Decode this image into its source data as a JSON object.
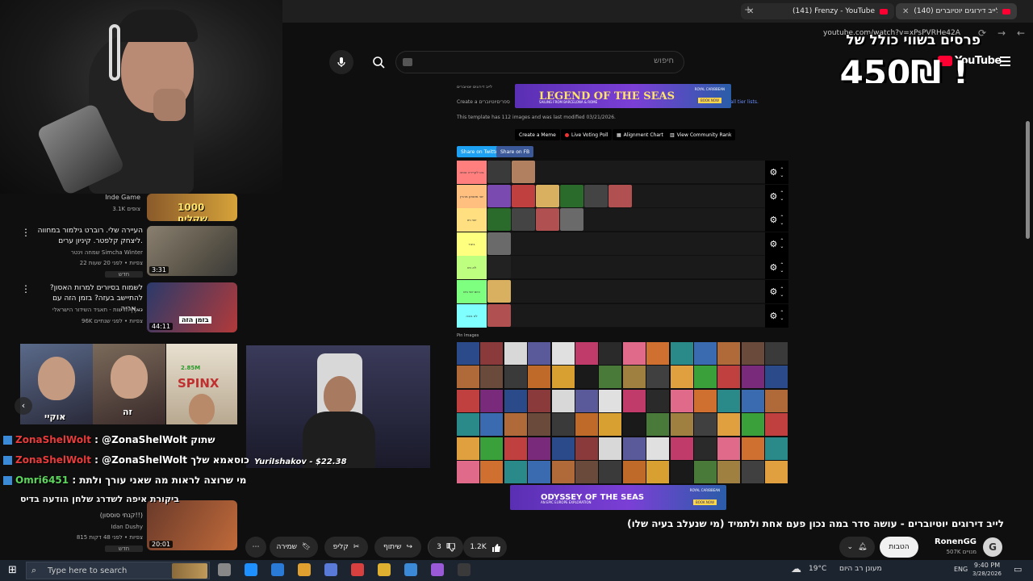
{
  "browser": {
    "tabs": [
      {
        "label": "(141) Frenzy - YouTube"
      },
      {
        "label": "(140) לייב דירוגים יוטיוברים"
      }
    ],
    "url": "youtube.com/watch?v=xPsPVRHe42A"
  },
  "youtube": {
    "logo_text": "YouTube",
    "search_placeholder": "חיפוש"
  },
  "overlay": {
    "line1": "פרסים בשווי כולל של",
    "line2": "450₪ !"
  },
  "tier_page": {
    "heading": "לייב דירוגים יוטיוברים",
    "create_line": "Create a ספריםיוטיוברים",
    "tier_lists_link": "all tier lists.",
    "template_info": "This template has 112 images and was last modified 03/21/2026.",
    "buttons": [
      "Create a Meme",
      "Live Voting Poll",
      "Alignment Chart",
      "View Community Rank"
    ],
    "share_buttons": [
      "Share on Twitter",
      "Share on FB"
    ],
    "tiers": [
      {
        "label": "גוט לקרירה אותה"
      },
      {
        "label": "יוטי מושפע מהרץ"
      },
      {
        "label": "יוטי ניט"
      },
      {
        "label": "ביגוד"
      },
      {
        "label": "לא ניט"
      },
      {
        "label": "היום יוטי ביט"
      },
      {
        "label": "לא בוכה"
      }
    ],
    "pin_label": "Pin Images"
  },
  "ads": {
    "top": {
      "title": "LEGEND OF THE SEAS",
      "sub": "SAILING FROM BARCELONA & ROME",
      "brand": "ROYAL CARIBBEAN",
      "cta": "BOOK NOW"
    },
    "bottom": {
      "title": "ODYSSEY OF THE SEAS",
      "sub": "AN EPIC EUROPE EXPLORATION",
      "brand": "ROYAL CARIBBEAN",
      "cta": "BOOK NOW"
    }
  },
  "sidebar": {
    "items": [
      {
        "channel": "Inde Game",
        "meta": "3.1K צופים",
        "badge": "1000 שקלים"
      },
      {
        "title": "העיירה שלי. רוברט גילמור במחווה ליצחק קלפטר. קיניון ערים.",
        "channel": "שמחה וינטר Simcha Winter",
        "meta": "22 צפיות • לפני 20 שעות",
        "tag": "חדש",
        "duration": "3:31"
      },
      {
        "title": "לשמוח בסיורים למרות האסון? להתיישב בעזה? בזמן הזה עם אריה...",
        "channel": "כאן | חדשות - תאגיד השידור הישראלי",
        "meta": "96K צפיות • לפני שנתיים",
        "duration": "44:11",
        "badge": "בזמן הזה"
      },
      {
        "title": "ביקורת איפה לשדרג שלחן הודעה בדיס",
        "sub": "(קנתי סוססון!!)",
        "channel": "Idan Dushy",
        "meta": "815 צפיות • לפני 48 דקות",
        "tag": "חדש",
        "duration": "20:01"
      }
    ]
  },
  "stream_cam": {
    "overlay_names": [
      "אוקיי",
      "זה"
    ],
    "spinx": "SPINX",
    "spinx_amount": "2.85M",
    "donation": "YuriIshakov - $22.38"
  },
  "chat": [
    {
      "user": "ZonaShelWolt",
      "text": ": @ZonaShelWolt שתוק",
      "color": "#e83b3b"
    },
    {
      "user": "ZonaShelWolt",
      "text": ": @ZonaShelWolt כוסאמא שלך",
      "color": "#e83b3b"
    },
    {
      "user": "Omri6451",
      "text": ": מי שרוצה לראות מה שאני עורך ולתת",
      "color": "#5ed65e"
    }
  ],
  "video": {
    "title": "לייב דירוגים יוטיוברים - עושה סדר במה נכון פעם אחת ולתמיד (מי שנעלב בעיה שלו)",
    "channel": "RonenGG",
    "subs": "507K מנויים",
    "subscribe": "הטבות",
    "likes": "1.2K",
    "dislikes": "3",
    "share": "שיתוף",
    "clip": "קליפ",
    "save": "שמירה"
  },
  "taskbar": {
    "search_placeholder": "Type here to search",
    "weather": "19°C",
    "weather_text": "מעונן רב היום",
    "lang": "ENG",
    "time": "9:40 PM",
    "date": "3/28/2026"
  },
  "colors": {
    "tiers": [
      "#ff7f7f",
      "#ffbf7f",
      "#ffdf7f",
      "#ffff7f",
      "#bfff7f",
      "#7fff7f",
      "#7fffff"
    ],
    "ad_purple": "#5a2fb3",
    "subscribe_bg": "#f1f1f1"
  }
}
